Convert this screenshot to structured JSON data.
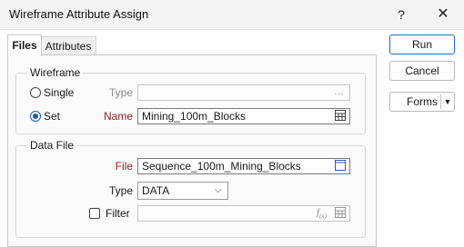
{
  "window": {
    "title": "Wireframe Attribute Assign",
    "help_label": "?",
    "close_label": "✕"
  },
  "tabs": [
    {
      "label": "Files"
    },
    {
      "label": "Attributes"
    }
  ],
  "wireframe": {
    "legend": "Wireframe",
    "single_label": "Single",
    "set_label": "Set",
    "selected": "Set",
    "type_label": "Type",
    "type_value": "",
    "name_label": "Name",
    "name_value": "Mining_100m_Blocks"
  },
  "data_file": {
    "legend": "Data File",
    "file_label": "File",
    "file_value": "Sequence_100m_Mining_Blocks",
    "type_label": "Type",
    "type_value": "DATA",
    "filter_label": "Filter",
    "filter_checked": false,
    "filter_value": ""
  },
  "buttons": {
    "run": "Run",
    "cancel": "Cancel",
    "forms": "Forms"
  },
  "icons": {
    "browse": "ellipsis-icon",
    "table": "table-icon",
    "file_browse": "file-browse-icon",
    "expression": "fx-icon",
    "dropdown": "chevron-down-icon"
  },
  "colors": {
    "accent": "#1a5fb4",
    "required_label": "#9b1b1b",
    "disabled_label": "#8a8a8a"
  }
}
